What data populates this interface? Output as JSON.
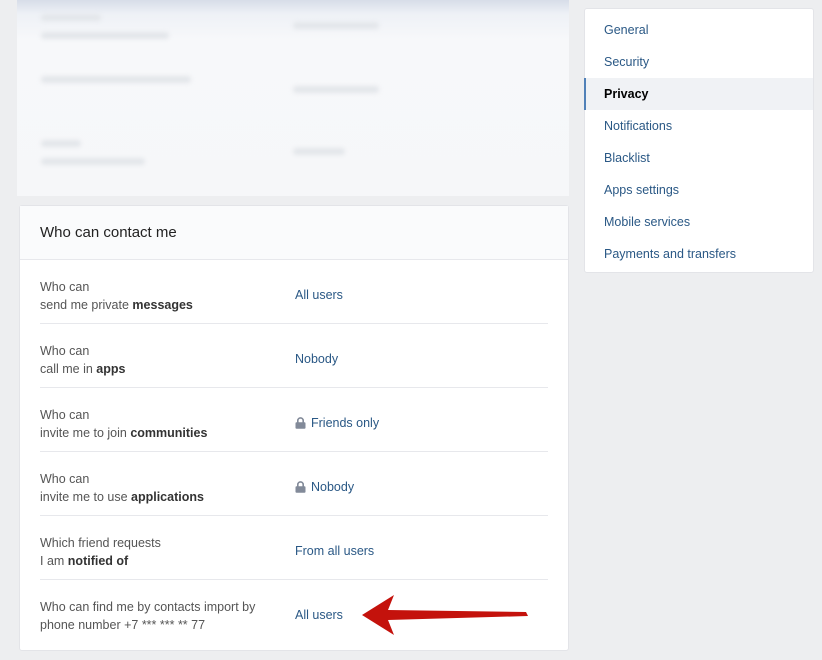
{
  "contact_section": {
    "title": "Who can contact me",
    "rows": [
      {
        "label_prefix": "Who can",
        "label_line2_plain": "send me private ",
        "label_line2_bold": "messages",
        "value": "All users",
        "locked": false
      },
      {
        "label_prefix": "Who can",
        "label_line2_plain": "call me in ",
        "label_line2_bold": "apps",
        "value": "Nobody",
        "locked": false
      },
      {
        "label_prefix": "Who can",
        "label_line2_plain": "invite me to join ",
        "label_line2_bold": "communities",
        "value": "Friends only",
        "locked": true
      },
      {
        "label_prefix": "Who can",
        "label_line2_plain": "invite me to use ",
        "label_line2_bold": "applications",
        "value": "Nobody",
        "locked": true
      },
      {
        "label_prefix": "Which friend requests",
        "label_line2_plain": "I am ",
        "label_line2_bold": "notified of",
        "value": "From all users",
        "locked": false
      },
      {
        "label_prefix": "Who can find me by contacts import by",
        "label_line2_plain": "phone number +7 *** *** ** 77",
        "label_line2_bold": "",
        "value": "All users",
        "locked": false
      }
    ]
  },
  "side_menu": {
    "items": [
      {
        "label": "General",
        "active": false
      },
      {
        "label": "Security",
        "active": false
      },
      {
        "label": "Privacy",
        "active": true
      },
      {
        "label": "Notifications",
        "active": false
      },
      {
        "label": "Blacklist",
        "active": false
      },
      {
        "label": "Apps settings",
        "active": false
      },
      {
        "label": "Mobile services",
        "active": false
      },
      {
        "label": "Payments and transfers",
        "active": false
      }
    ]
  },
  "colors": {
    "link": "#2a5885",
    "active_marker": "#5181b8",
    "arrow": "#c4120c",
    "page_bg": "#edeef0"
  },
  "icons": {
    "lock": "lock-icon",
    "annotation_arrow": "red-arrow-icon"
  }
}
